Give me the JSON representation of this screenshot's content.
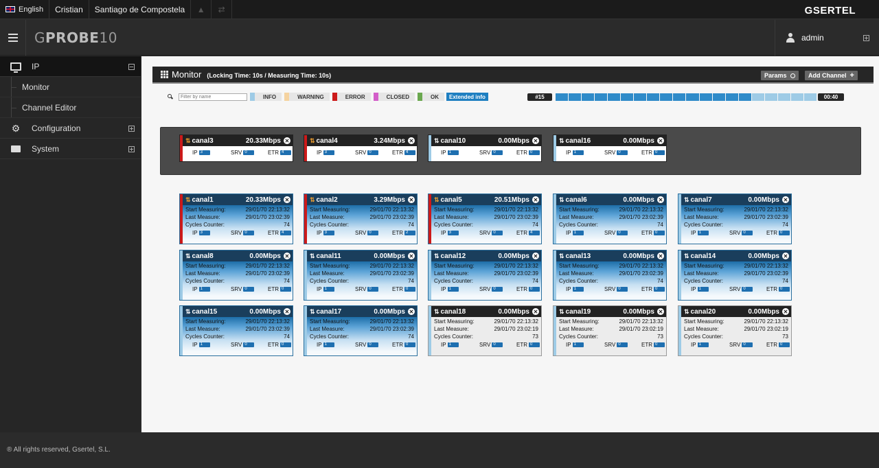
{
  "topbar": {
    "language": "English",
    "user_name": "Cristian",
    "location": "Santiago de Compostela",
    "brand": "GSERTEL"
  },
  "header": {
    "logo_prefix": "G",
    "logo_bold": "PROBE",
    "logo_suffix": "10",
    "user": "admin"
  },
  "sidebar": {
    "sections": [
      {
        "label": "IP",
        "icon": "monitor-icon"
      },
      {
        "label": "Configuration",
        "icon": "gear-icon"
      },
      {
        "label": "System",
        "icon": "drive-icon"
      }
    ],
    "sub_items": [
      "Monitor",
      "Channel Editor"
    ]
  },
  "footer": "® All rights reserved, Gsertel, S.L.",
  "monitor": {
    "title": "Monitor",
    "subtitle": "(Locking Time: 10s / Measuring Time: 10s)",
    "params_label": "Params",
    "add_channel_label": "Add Channel",
    "filter_placeholder": "Filter by name",
    "legend": [
      {
        "label": "INFO",
        "color": "#9ecbe6"
      },
      {
        "label": "WARNING",
        "color": "#f5d3a0"
      },
      {
        "label": "ERROR",
        "color": "#cc1a1a"
      },
      {
        "label": "CLOSED",
        "color": "#d35fc9"
      },
      {
        "label": "OK",
        "color": "#6aa84f"
      }
    ],
    "extended_info_label": "Extended info",
    "cycle": "#15",
    "timer": "00:40",
    "progress_segments_filled": 15,
    "progress_segments_total": 20
  },
  "labels": {
    "start": "Start Measuring:",
    "last": "Last Measure:",
    "cycles": "Cycles Counter:",
    "ip": "IP",
    "srv": "SRV",
    "etr": "ETR"
  },
  "top_channels": [
    {
      "name": "canal3",
      "rate": "20.33Mbps",
      "ip": "3",
      "srv": "0",
      "etr": "4",
      "status": "error"
    },
    {
      "name": "canal4",
      "rate": "3.24Mbps",
      "ip": "3",
      "srv": "0",
      "etr": "4",
      "status": "error"
    },
    {
      "name": "canal10",
      "rate": "0.00Mbps",
      "ip": "1",
      "srv": "0",
      "etr": "0",
      "status": "info"
    },
    {
      "name": "canal16",
      "rate": "0.00Mbps",
      "ip": "1",
      "srv": "0",
      "etr": "0",
      "status": "info"
    }
  ],
  "channels": [
    {
      "name": "canal1",
      "rate": "20.33Mbps",
      "start": "29/01/70 22:13:32",
      "last": "29/01/70 23:02:39",
      "cycles": "74",
      "ip": "3",
      "srv": "0",
      "etr": "4",
      "status": "error",
      "style": "grad"
    },
    {
      "name": "canal2",
      "rate": "3.29Mbps",
      "start": "29/01/70 22:13:32",
      "last": "29/01/70 23:02:39",
      "cycles": "74",
      "ip": "3",
      "srv": "0",
      "etr": "2",
      "status": "error",
      "style": "grad"
    },
    {
      "name": "canal5",
      "rate": "20.51Mbps",
      "start": "29/01/70 22:13:32",
      "last": "29/01/70 23:02:39",
      "cycles": "74",
      "ip": "3",
      "srv": "0",
      "etr": "4",
      "status": "error",
      "style": "grad"
    },
    {
      "name": "canal6",
      "rate": "0.00Mbps",
      "start": "29/01/70 22:13:32",
      "last": "29/01/70 23:02:39",
      "cycles": "74",
      "ip": "1",
      "srv": "0",
      "etr": "0",
      "status": "info",
      "style": "grad"
    },
    {
      "name": "canal7",
      "rate": "0.00Mbps",
      "start": "29/01/70 22:13:32",
      "last": "29/01/70 23:02:39",
      "cycles": "74",
      "ip": "1",
      "srv": "0",
      "etr": "0",
      "status": "info",
      "style": "grad"
    },
    {
      "name": "canal8",
      "rate": "0.00Mbps",
      "start": "29/01/70 22:13:32",
      "last": "29/01/70 23:02:39",
      "cycles": "74",
      "ip": "1",
      "srv": "0",
      "etr": "0",
      "status": "info",
      "style": "grad"
    },
    {
      "name": "canal11",
      "rate": "0.00Mbps",
      "start": "29/01/70 22:13:32",
      "last": "29/01/70 23:02:39",
      "cycles": "74",
      "ip": "1",
      "srv": "0",
      "etr": "0",
      "status": "info",
      "style": "grad"
    },
    {
      "name": "canal12",
      "rate": "0.00Mbps",
      "start": "29/01/70 22:13:32",
      "last": "29/01/70 23:02:39",
      "cycles": "74",
      "ip": "1",
      "srv": "0",
      "etr": "0",
      "status": "info",
      "style": "grad"
    },
    {
      "name": "canal13",
      "rate": "0.00Mbps",
      "start": "29/01/70 22:13:32",
      "last": "29/01/70 23:02:39",
      "cycles": "74",
      "ip": "1",
      "srv": "0",
      "etr": "0",
      "status": "info",
      "style": "grad"
    },
    {
      "name": "canal14",
      "rate": "0.00Mbps",
      "start": "29/01/70 22:13:32",
      "last": "29/01/70 23:02:39",
      "cycles": "74",
      "ip": "1",
      "srv": "0",
      "etr": "0",
      "status": "info",
      "style": "grad"
    },
    {
      "name": "canal15",
      "rate": "0.00Mbps",
      "start": "29/01/70 22:13:32",
      "last": "29/01/70 23:02:39",
      "cycles": "74",
      "ip": "1",
      "srv": "0",
      "etr": "0",
      "status": "info",
      "style": "grad"
    },
    {
      "name": "canal17",
      "rate": "0.00Mbps",
      "start": "29/01/70 22:13:32",
      "last": "29/01/70 23:02:39",
      "cycles": "74",
      "ip": "1",
      "srv": "0",
      "etr": "0",
      "status": "info",
      "style": "grad"
    },
    {
      "name": "canal18",
      "rate": "0.00Mbps",
      "start": "29/01/70 22:13:32",
      "last": "29/01/70 23:02:19",
      "cycles": "73",
      "ip": "1",
      "srv": "0",
      "etr": "0",
      "status": "info",
      "style": "plain"
    },
    {
      "name": "canal19",
      "rate": "0.00Mbps",
      "start": "29/01/70 22:13:32",
      "last": "29/01/70 23:02:19",
      "cycles": "73",
      "ip": "1",
      "srv": "0",
      "etr": "0",
      "status": "info",
      "style": "plain"
    },
    {
      "name": "canal20",
      "rate": "0.00Mbps",
      "start": "29/01/70 22:13:32",
      "last": "29/01/70 23:02:19",
      "cycles": "73",
      "ip": "1",
      "srv": "0",
      "etr": "0",
      "status": "info",
      "style": "plain"
    }
  ],
  "colors": {
    "error": "#cc1a1a",
    "info": "#9ecbe6",
    "badge": "#1e6fb0",
    "accent": "#1e7fc1",
    "progress_filled": "#2f8bc9",
    "progress_empty": "#9ecbe6"
  }
}
